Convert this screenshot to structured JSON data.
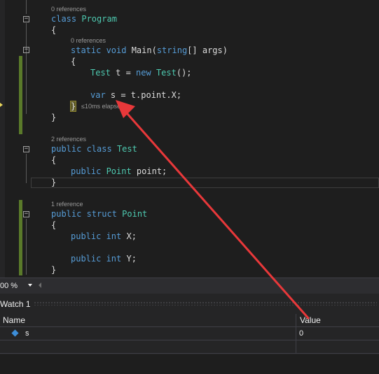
{
  "editor": {
    "lens": {
      "program_refs": "0 references",
      "main_refs": "0 references",
      "test_refs": "2 references",
      "point_refs": "1 reference"
    },
    "code": {
      "l_class_program": [
        "class ",
        "Program"
      ],
      "l_open1": "{",
      "l_main": [
        "static ",
        "void ",
        "Main(",
        "string",
        "[] args)"
      ],
      "l_open2": "{",
      "l_test_new": [
        "Test",
        " t = ",
        "new ",
        "Test",
        "();"
      ],
      "l_var": [
        "var",
        " s = t.point.X;"
      ],
      "l_close2": "}",
      "l_close1": "}",
      "l_class_test": [
        "public ",
        "class ",
        "Test"
      ],
      "l_open3": "{",
      "l_point_field": [
        "public ",
        "Point",
        " point;"
      ],
      "l_close3": "}",
      "l_struct": [
        "public ",
        "struct ",
        "Point"
      ],
      "l_open4": "{",
      "l_x": [
        "public ",
        "int",
        " X;"
      ],
      "l_y": [
        "public ",
        "int",
        " Y;"
      ],
      "l_close4": "}"
    },
    "elapsed": "≤10ms elapsed",
    "fold_symbol": "−"
  },
  "statusbar": {
    "zoom": "00 %"
  },
  "watch": {
    "title": "Watch 1",
    "columns": {
      "name": "Name",
      "value": "Value"
    },
    "rows": [
      {
        "name": "s",
        "value": "0",
        "icon": "field-icon"
      }
    ]
  },
  "colors": {
    "keyword": "#569cd6",
    "type": "#4ec9b0",
    "annotation_arrow": "#e8383a",
    "change_bar": "#5a7a2a"
  }
}
